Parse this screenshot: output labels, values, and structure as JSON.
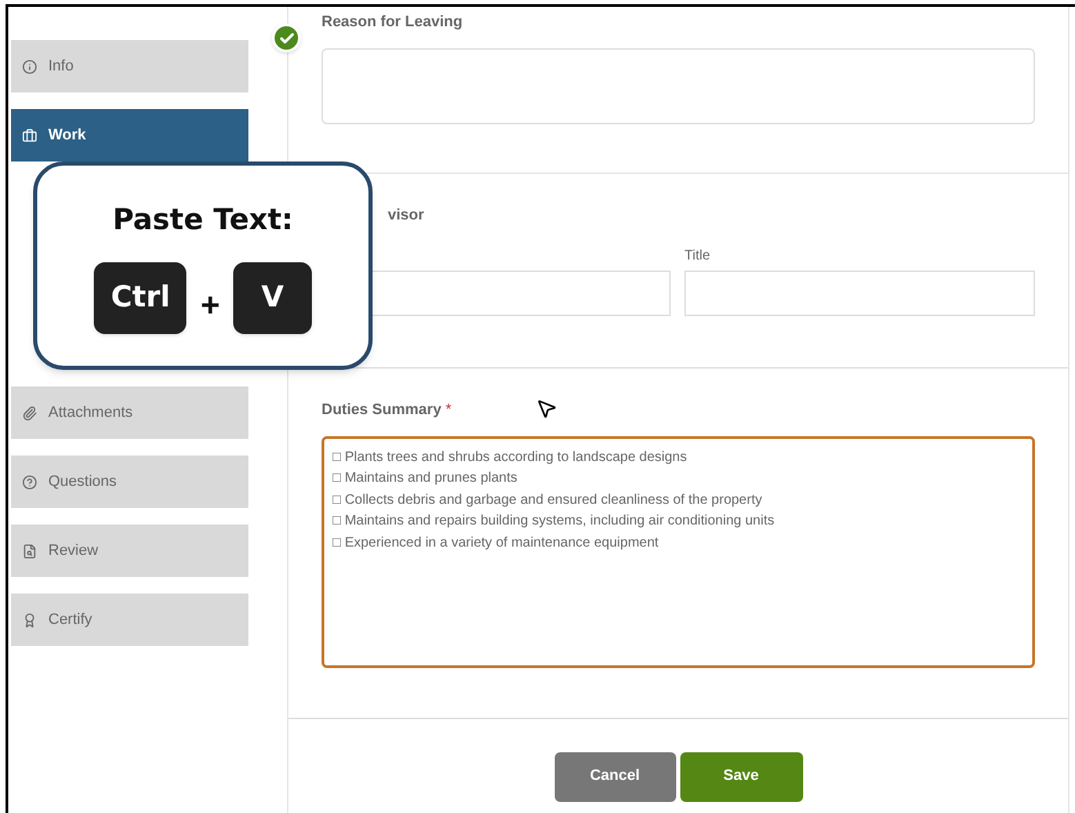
{
  "sidebar": {
    "items": [
      {
        "label": "Info",
        "selected": false,
        "completed": true
      },
      {
        "label": "Work",
        "selected": true,
        "completed": false
      },
      {
        "label": "Attachments",
        "selected": false,
        "completed": false
      },
      {
        "label": "Questions",
        "selected": false,
        "completed": false
      },
      {
        "label": "Review",
        "selected": false,
        "completed": false
      },
      {
        "label": "Certify",
        "selected": false,
        "completed": false
      }
    ]
  },
  "form": {
    "reason_label": "Reason for Leaving",
    "supervisor_label": "visor",
    "title_label": "Title",
    "duties_label": "Duties Summary",
    "duties_required_mark": "*",
    "duties_value": "□ Plants trees and shrubs according to landscape designs\n□ Maintains and prunes plants\n□ Collects debris and garbage and ensured cleanliness of the property\n□ Maintains and repairs building systems, including air conditioning units\n□ Experienced in a variety of maintenance equipment",
    "duties_focused": true,
    "buttons": [
      {
        "label": "Cancel",
        "kind": "secondary"
      },
      {
        "label": "Save",
        "kind": "primary"
      }
    ]
  },
  "overlay": {
    "title": "Paste Text:",
    "keys": [
      "Ctrl",
      "V"
    ],
    "joiner": "+"
  }
}
